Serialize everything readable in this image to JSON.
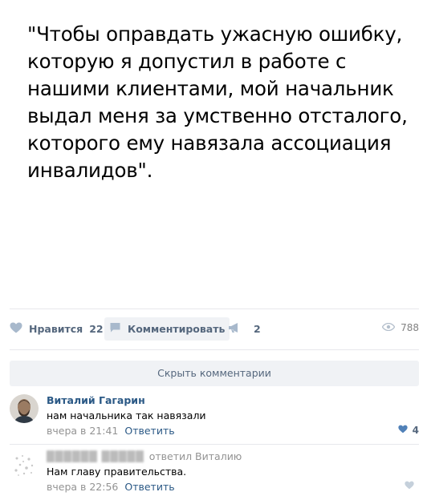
{
  "post": {
    "text": "\"Чтобы оправдать ужасную ошибку, которую я допустил в работе с нашими клиентами, мой начальник выдал меня за умственно отсталого, которого ему навязала ассоциация инвалидов\"."
  },
  "actions": {
    "like_label": "Нравится",
    "like_count": "22",
    "comment_label": "Комментировать",
    "share_count": "2",
    "views_count": "788"
  },
  "comments_section": {
    "hide_label": "Скрыть комментарии"
  },
  "comments": [
    {
      "author": "Виталий Гагарин",
      "text": "нам начальника так навязали",
      "time": "вчера в 21:41",
      "reply_label": "Ответить",
      "likes": "4"
    },
    {
      "author_blurred": "██████ █████",
      "author_suffix": "ответил Виталию",
      "text": "Нам главу правительства.",
      "time": "вчера в 22:56",
      "reply_label": "Ответить"
    }
  ],
  "colors": {
    "link": "#2a5885",
    "action": "#55677d",
    "muted": "#939393",
    "divider": "#e7e8ec",
    "button_bg": "#f0f2f5",
    "heart_active": "#5181b8"
  }
}
